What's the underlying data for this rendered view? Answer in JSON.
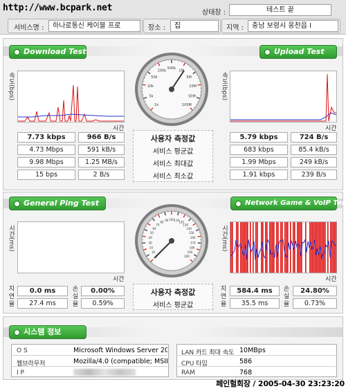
{
  "header": {
    "watermark": "http://www.bcpark.net",
    "status_label": "상태창 :",
    "status_value": "테스트 끝",
    "service_label": "서비스명 :",
    "service_value": "하나로통신 케이블 프로",
    "place_label": "장소 :",
    "place_value": "집",
    "region_label": "지역 :",
    "region_value": "충남 보령시 웅천읍 I"
  },
  "speed": {
    "download_button": "Download Test",
    "upload_button": "Upload Test",
    "ylabel": "속도(bps)",
    "xlabel": "시간",
    "rows": [
      {
        "label": "사용자 측정값",
        "down_bps": "7.73 kbps",
        "down_bs": "966 B/s",
        "up_bps": "5.79 kbps",
        "up_bs": "724 B/s"
      },
      {
        "label": "서비스 평균값",
        "down_bps": "4.73 Mbps",
        "down_bs": "591 kB/s",
        "up_bps": "683 kbps",
        "up_bs": "85.4 kB/s"
      },
      {
        "label": "서비스 최대값",
        "down_bps": "9.98 Mbps",
        "down_bs": "1.25 MB/s",
        "up_bps": "1.99 Mbps",
        "up_bs": "249 kB/s"
      },
      {
        "label": "서비스 최소값",
        "down_bps": "15 bps",
        "down_bs": "2 B/s",
        "up_bps": "1.91 kbps",
        "up_bs": "239 B/s"
      }
    ],
    "gauge_ticks": [
      "1k",
      "5k",
      "10k",
      "50k",
      "100k",
      "500k",
      "1M",
      "5M",
      "10M",
      "50M",
      "100M"
    ]
  },
  "ping": {
    "ping_button": "General Ping Test",
    "game_button": "Network Game & VoIP Test",
    "ylabel": "시간(ms)",
    "xlabel": "시간",
    "delay_label": "지연율",
    "loss_label": "손실율",
    "rows": [
      {
        "label": "사용자 측정값",
        "ping_delay": "0.0 ms",
        "ping_loss": "0.00%",
        "game_delay": "584.4 ms",
        "game_loss": "24.80%"
      },
      {
        "label": "서비스 평균값",
        "ping_delay": "27.4 ms",
        "ping_loss": "0.59%",
        "game_delay": "35.5 ms",
        "game_loss": "0.73%"
      }
    ],
    "gauge_ticks": [
      "0",
      "10",
      "20",
      "30",
      "40",
      "50",
      "60",
      "70",
      "80",
      "90",
      "100",
      "110",
      "120",
      "130",
      "140",
      "150",
      "160",
      "170",
      "180",
      "190",
      "200"
    ]
  },
  "system": {
    "button": "시스템 정보",
    "os_label": "O S",
    "os_value": "Microsoft Windows Server 20",
    "browser_label": "웹브라우저",
    "browser_value": "Mozilla/4.0 (compatible; MSIE",
    "ip_label": "I P",
    "lan_label": "LAN 카드 최대 속도",
    "lan_value": "10MBps",
    "cpu_label": "CPU 타입",
    "cpu_value": "586",
    "ram_label": "RAM",
    "ram_value": "768"
  },
  "footer": "페인헐회장 / 2005-04-30 23:23:20",
  "colors": {
    "accent_green": "#33a033",
    "graph_red": "#e01010",
    "graph_blue": "#2233cc"
  }
}
